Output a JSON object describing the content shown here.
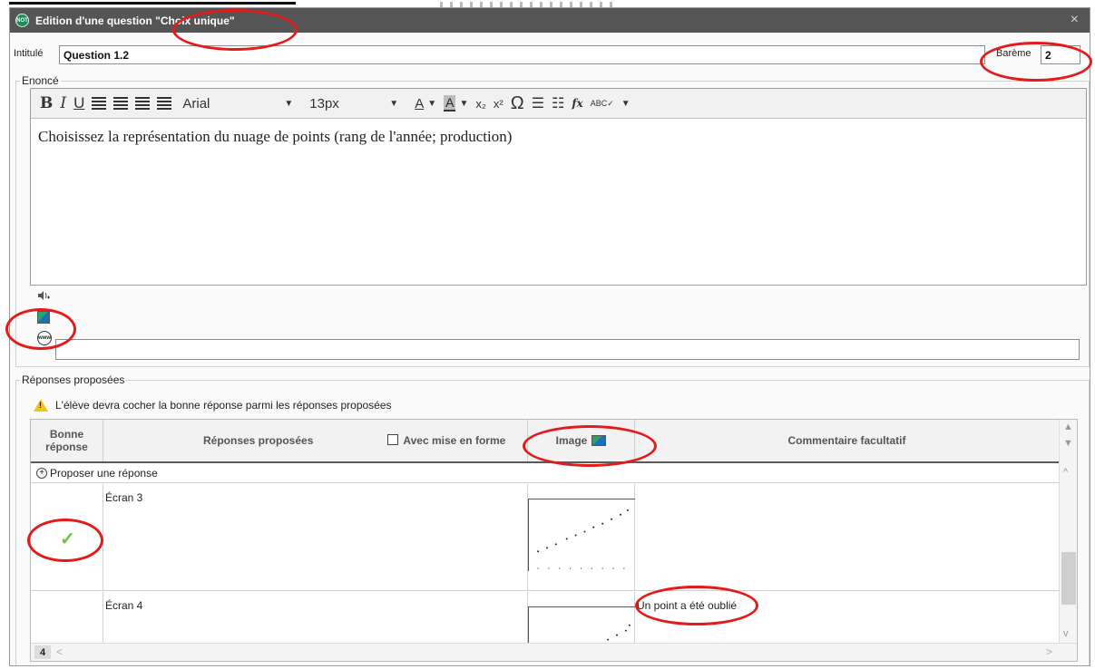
{
  "window": {
    "logo_text": "NOT",
    "title": "Edition d'une question \"Choix unique\"",
    "close_symbol": "×"
  },
  "form": {
    "intitule_label": "Intitulé",
    "intitule_value": "Question 1.2",
    "bareme_label": "Barème",
    "bareme_value": "2"
  },
  "enonce": {
    "legend": "Enoncé",
    "toolbar": {
      "bold": "B",
      "italic": "I",
      "underline": "U",
      "font": "Arial",
      "size": "13px",
      "color": "A",
      "highlight": "A",
      "subscript": "x₂",
      "superscript": "x²",
      "omega": "Ω",
      "formula": "fx",
      "spell": "ABC✓"
    },
    "text": "Choisissez la représentation du nuage de points (rang de l'année; production)"
  },
  "media": {
    "link_label": "www",
    "url_value": ""
  },
  "reponses": {
    "legend": "Réponses proposées",
    "warning": "L'élève devra cocher la bonne réponse parmi les réponses proposées",
    "columns": {
      "bonne": "Bonne réponse",
      "proposees": "Réponses proposées",
      "mise_en_forme": "Avec mise en forme",
      "image": "Image",
      "commentaire": "Commentaire facultatif"
    },
    "propose_label": "Proposer une réponse",
    "rows": [
      {
        "label": "Écran 3",
        "correct": true,
        "comment": ""
      },
      {
        "label": "Écran 4",
        "correct": false,
        "comment": "Un point a été oublié"
      }
    ],
    "count": "4"
  },
  "colors": {
    "titlebar": "#555555",
    "highlight": "#e31b1b",
    "check": "#6ebf3c"
  }
}
